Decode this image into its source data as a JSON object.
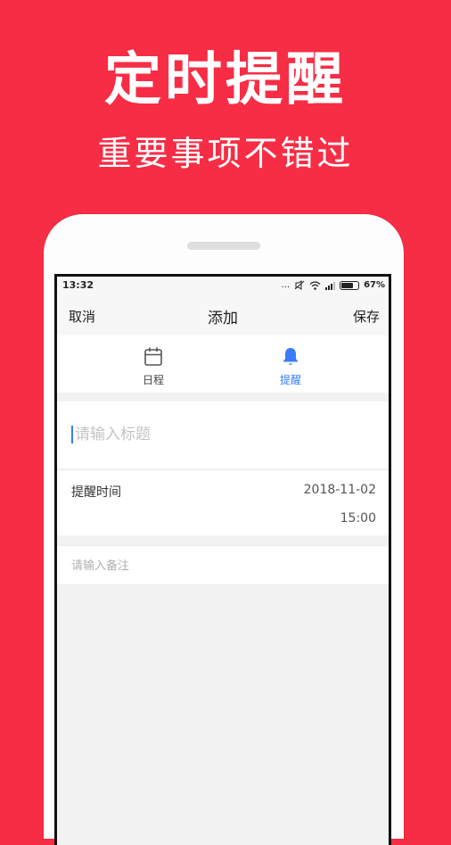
{
  "promo": {
    "title": "定时提醒",
    "subtitle": "重要事项不错过"
  },
  "status_bar": {
    "time": "13:32",
    "dots": "...",
    "battery_percent": "67%"
  },
  "nav": {
    "cancel_label": "取消",
    "title": "添加",
    "save_label": "保存"
  },
  "tabs": [
    {
      "label": "日程",
      "icon": "calendar-icon",
      "active": false
    },
    {
      "label": "提醒",
      "icon": "bell-icon",
      "active": true
    }
  ],
  "form": {
    "title_placeholder": "请输入标题",
    "remind_time_label": "提醒时间",
    "remind_date": "2018-11-02",
    "remind_time": "15:00",
    "note_placeholder": "请输入备注"
  },
  "colors": {
    "background": "#f72d45",
    "accent": "#3a7cf5"
  }
}
